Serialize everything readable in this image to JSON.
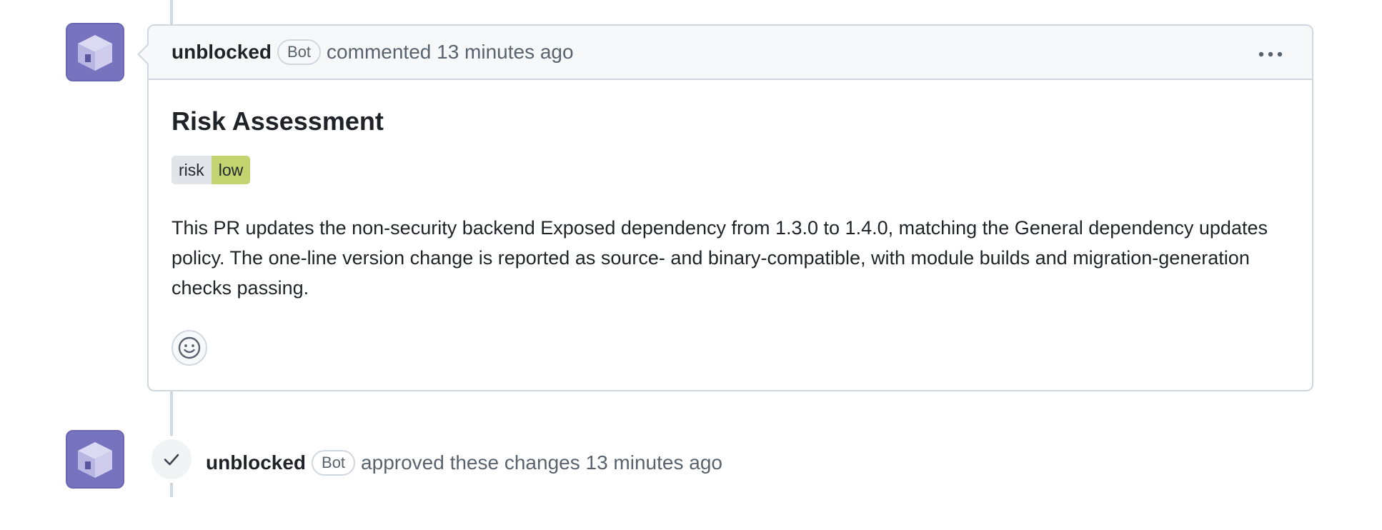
{
  "comment": {
    "author": "unblocked",
    "badge": "Bot",
    "action": "commented 13 minutes ago",
    "more_icon": "kebab-horizontal-icon",
    "title": "Risk Assessment",
    "risk_badge": {
      "key": "risk",
      "value": "low",
      "value_color": "#c3d370"
    },
    "body": "This PR updates the non-security backend Exposed dependency from 1.3.0 to 1.4.0, matching the General dependency updates policy. The one-line version change is reported as source- and binary-compatible, with module builds and migration-generation checks passing.",
    "reaction_icon": "smiley-icon"
  },
  "approval": {
    "author": "unblocked",
    "badge": "Bot",
    "action": "approved these changes 13 minutes ago",
    "status_icon": "check-icon"
  },
  "colors": {
    "avatar_bg": "#7773bf",
    "border": "#d0d7de",
    "header_bg": "#f6f8fa",
    "muted_text": "#59636e"
  }
}
